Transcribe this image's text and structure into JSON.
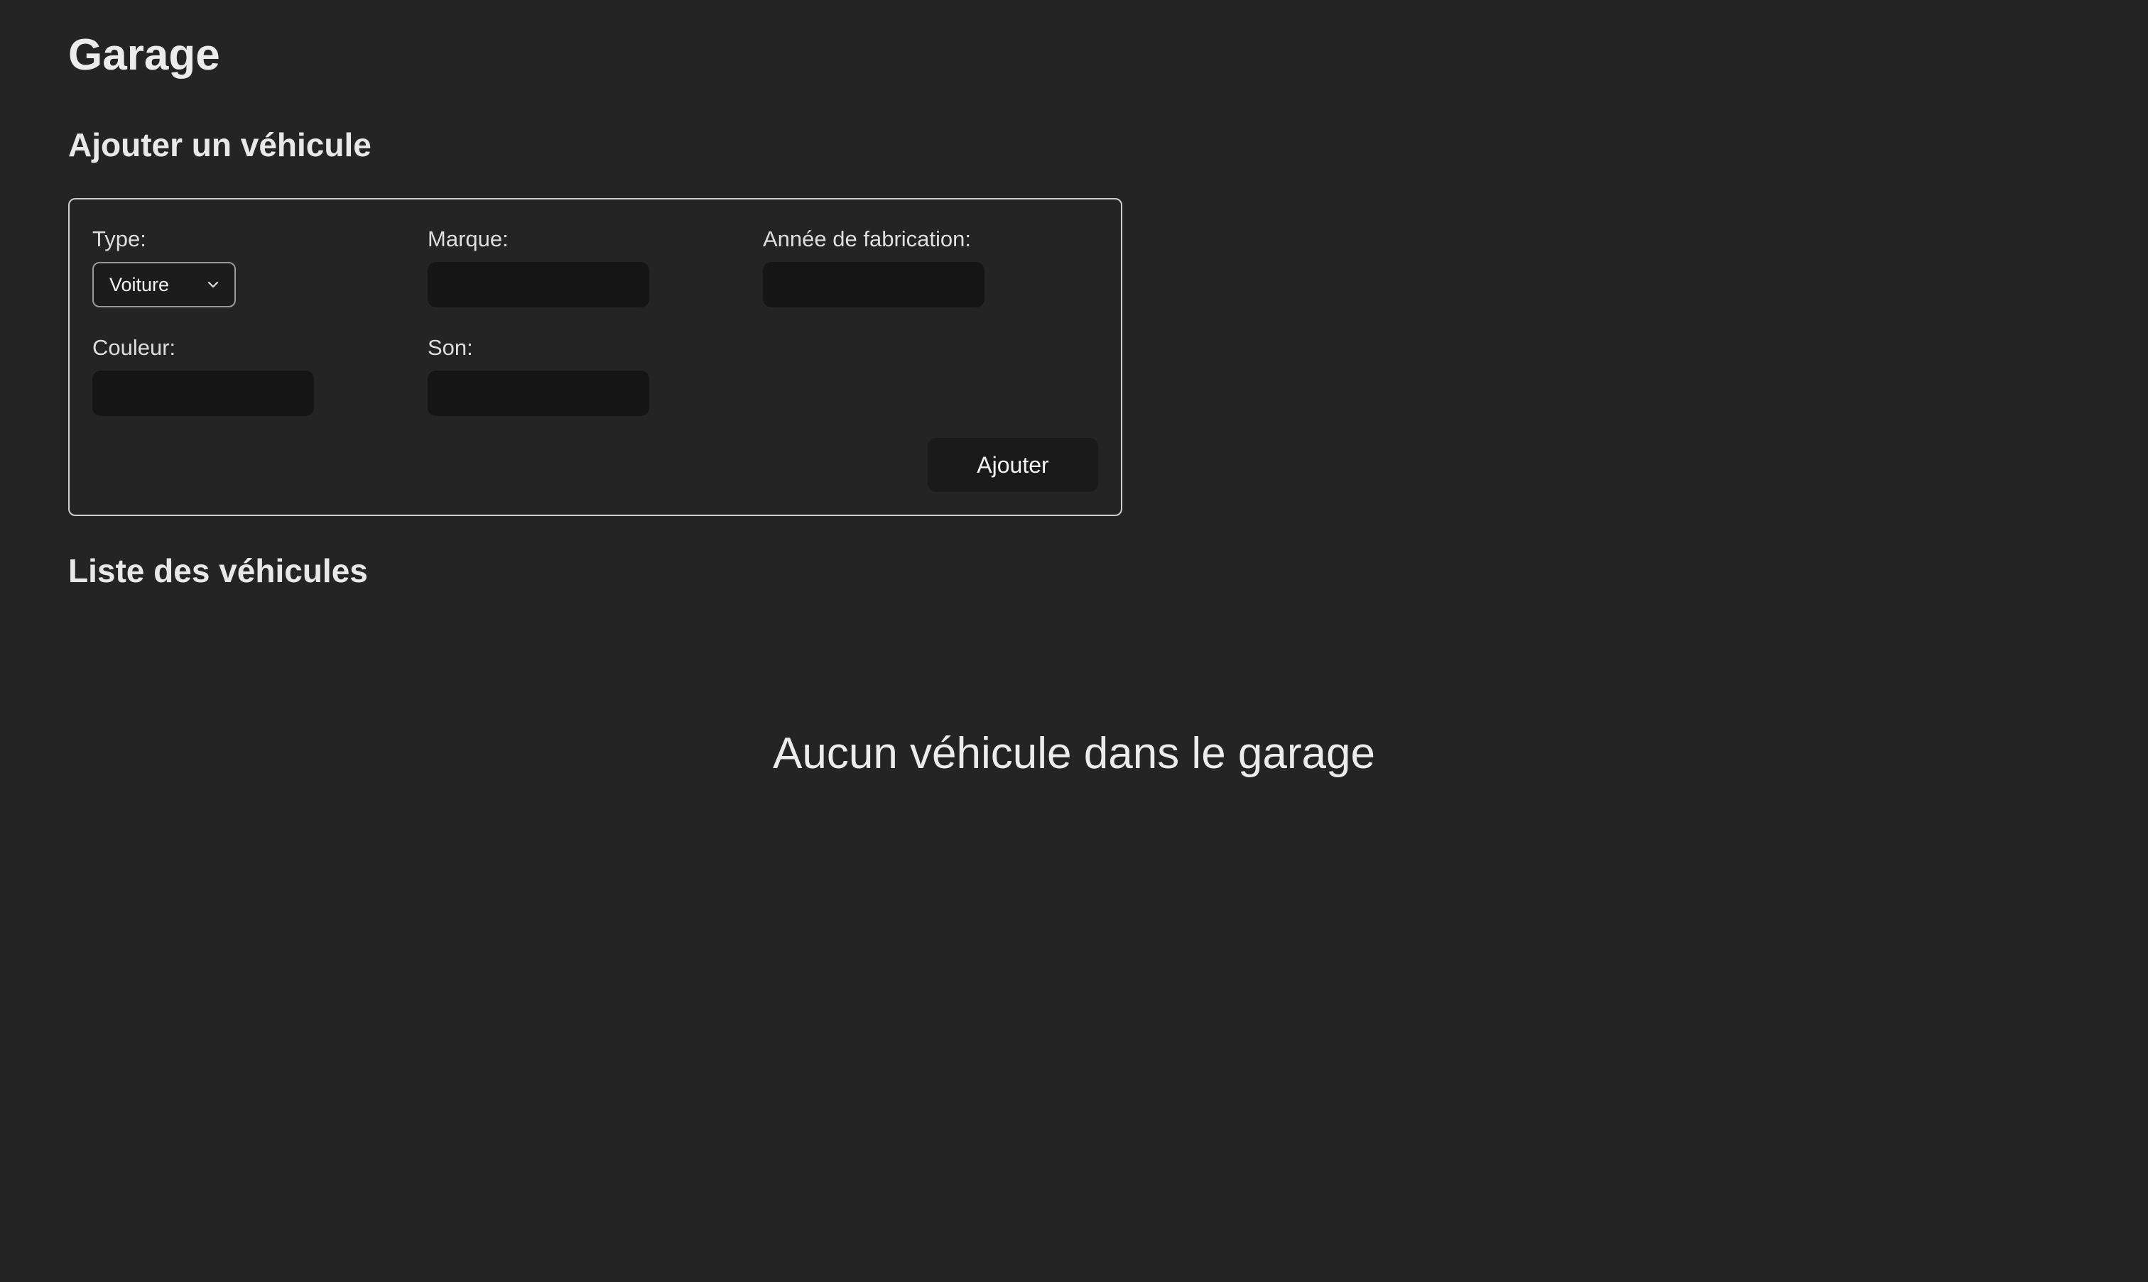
{
  "page": {
    "title": "Garage"
  },
  "add_section": {
    "title": "Ajouter un véhicule",
    "fields": {
      "type": {
        "label": "Type:",
        "selected": "Voiture",
        "icon": "chevron-down-icon"
      },
      "marque": {
        "label": "Marque:",
        "value": "",
        "placeholder": ""
      },
      "annee": {
        "label": "Année de fabrication:",
        "value": "",
        "placeholder": ""
      },
      "couleur": {
        "label": "Couleur:",
        "value": "",
        "placeholder": ""
      },
      "son": {
        "label": "Son:",
        "value": "",
        "placeholder": ""
      }
    },
    "submit_label": "Ajouter"
  },
  "list_section": {
    "title": "Liste des véhicules",
    "empty_message": "Aucun véhicule dans le garage"
  },
  "colors": {
    "background": "#242424",
    "input_background": "#151515",
    "button_background": "#1a1a1a",
    "card_border": "#cfcfcf",
    "text": "#e6e6e6"
  }
}
